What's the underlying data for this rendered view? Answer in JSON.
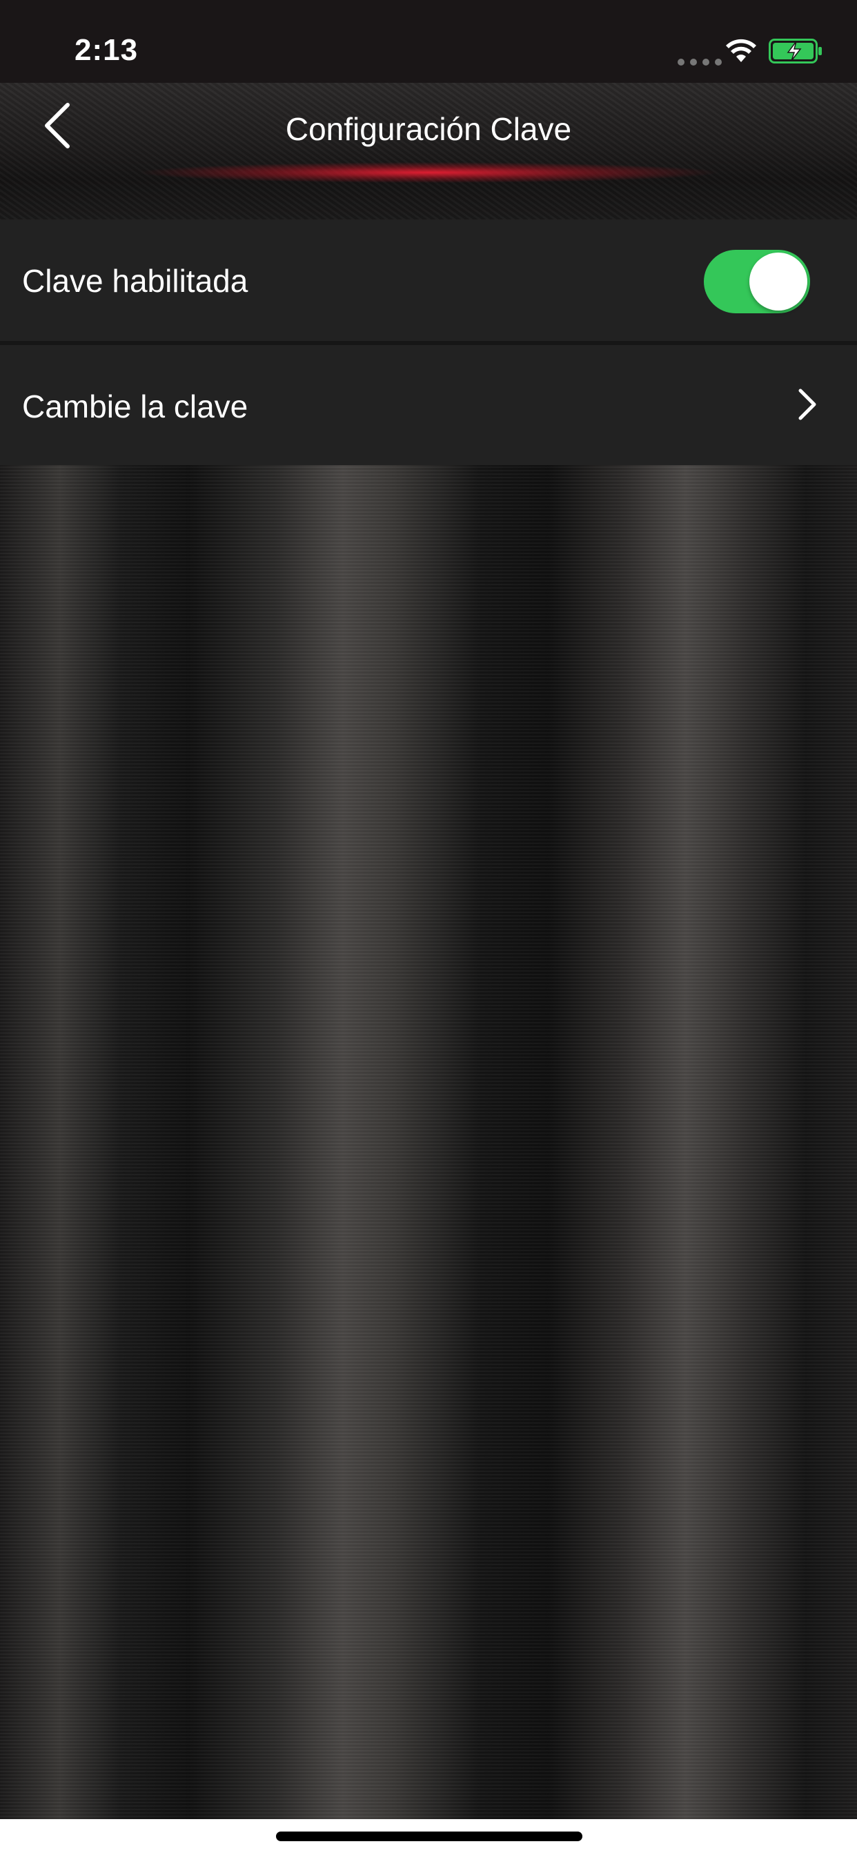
{
  "status_bar": {
    "time": "2:13",
    "icons": [
      "signal-dots-icon",
      "wifi-icon",
      "battery-charging-icon"
    ]
  },
  "nav": {
    "title": "Configuración Clave",
    "back_icon": "chevron-left-icon"
  },
  "settings": {
    "password_enabled": {
      "label": "Clave habilitada",
      "toggle_on": true,
      "toggle_color": "#34c759"
    },
    "change_password": {
      "label": "Cambie la clave",
      "icon": "chevron-right-icon"
    }
  },
  "colors": {
    "accent_red": "#e61e32",
    "battery_green": "#34c759"
  }
}
